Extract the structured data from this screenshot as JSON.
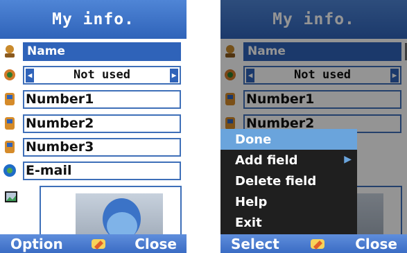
{
  "title": "My info.",
  "fields": {
    "name": "Name",
    "ringtone": "Not used",
    "number1": "Number1",
    "number2": "Number2",
    "number3": "Number3",
    "email": "E-mail"
  },
  "softkeys": {
    "left_left": "Option",
    "left_right": "Close",
    "right_left": "Select",
    "right_right": "Close"
  },
  "menu": {
    "items": [
      "Done",
      "Add field",
      "Delete field",
      "Help",
      "Exit"
    ],
    "selected": "Done",
    "submenu_on": "Add field"
  },
  "colors": {
    "accent": "#2f63b9",
    "menu_highlight": "#6aa4dc"
  },
  "icons": [
    "user-icon",
    "ringtone-icon",
    "phone-icon",
    "email-icon",
    "image-icon",
    "pencil-icon",
    "arrow-left-icon",
    "arrow-right-icon"
  ]
}
